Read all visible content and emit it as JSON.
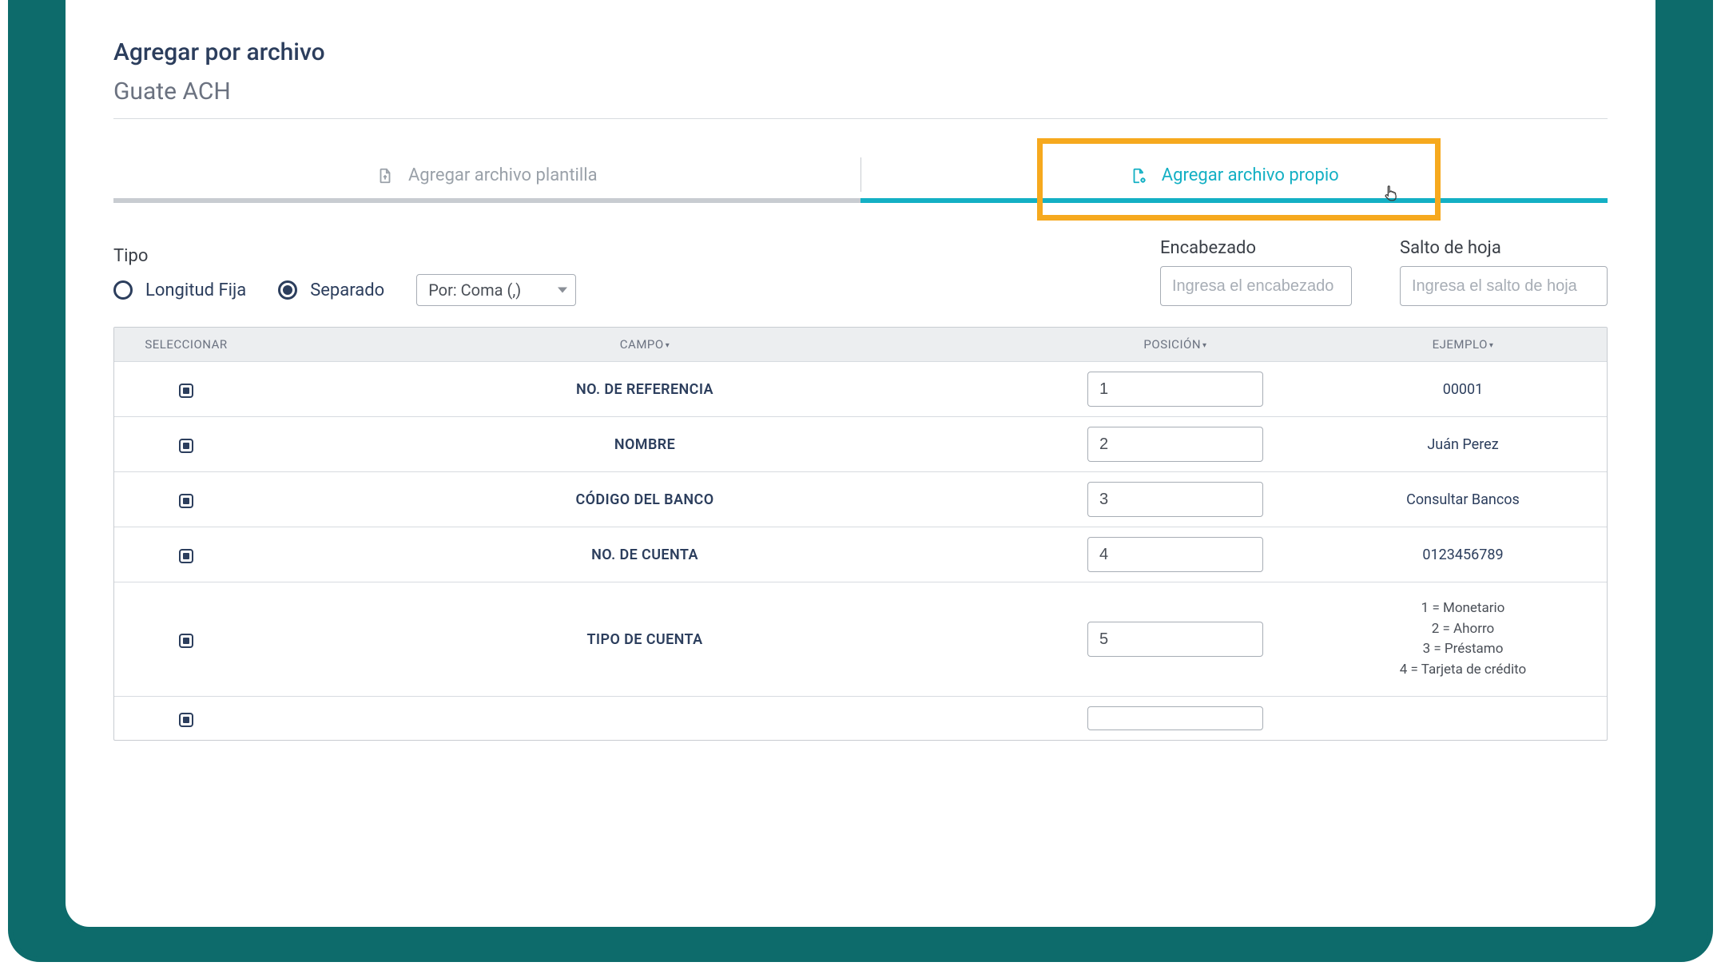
{
  "header": {
    "title": "Agregar por archivo",
    "subtitle": "Guate ACH"
  },
  "tabs": {
    "template": {
      "label": "Agregar archivo plantilla"
    },
    "own": {
      "label": "Agregar archivo propio"
    }
  },
  "controls": {
    "type_label": "Tipo",
    "radio_fixed": "Longitud Fija",
    "radio_separated": "Separado",
    "separator_select": "Por: Coma (,)",
    "header_field": {
      "label": "Encabezado",
      "placeholder": "Ingresa el encabezado"
    },
    "pagebreak_field": {
      "label": "Salto de hoja",
      "placeholder": "Ingresa el salto de hoja"
    }
  },
  "table": {
    "headers": {
      "select": "SELECCIONAR",
      "field": "CAMPO",
      "position": "POSICIÓN",
      "example": "EJEMPLO"
    },
    "rows": [
      {
        "field": "NO. DE REFERENCIA",
        "position": "1",
        "example": "00001"
      },
      {
        "field": "NOMBRE",
        "position": "2",
        "example": "Juán Perez"
      },
      {
        "field": "CÓDIGO DEL BANCO",
        "position": "3",
        "example": "Consultar Bancos"
      },
      {
        "field": "NO. DE CUENTA",
        "position": "4",
        "example": "0123456789"
      },
      {
        "field": "TIPO DE CUENTA",
        "position": "5",
        "example": "1 = Monetario\n2 = Ahorro\n3 = Préstamo\n4 = Tarjeta de crédito"
      }
    ]
  },
  "colors": {
    "frame": "#0d6b6b",
    "accent": "#14b0c4",
    "highlight": "#f6a91e",
    "text_heading": "#2c3e5d"
  }
}
